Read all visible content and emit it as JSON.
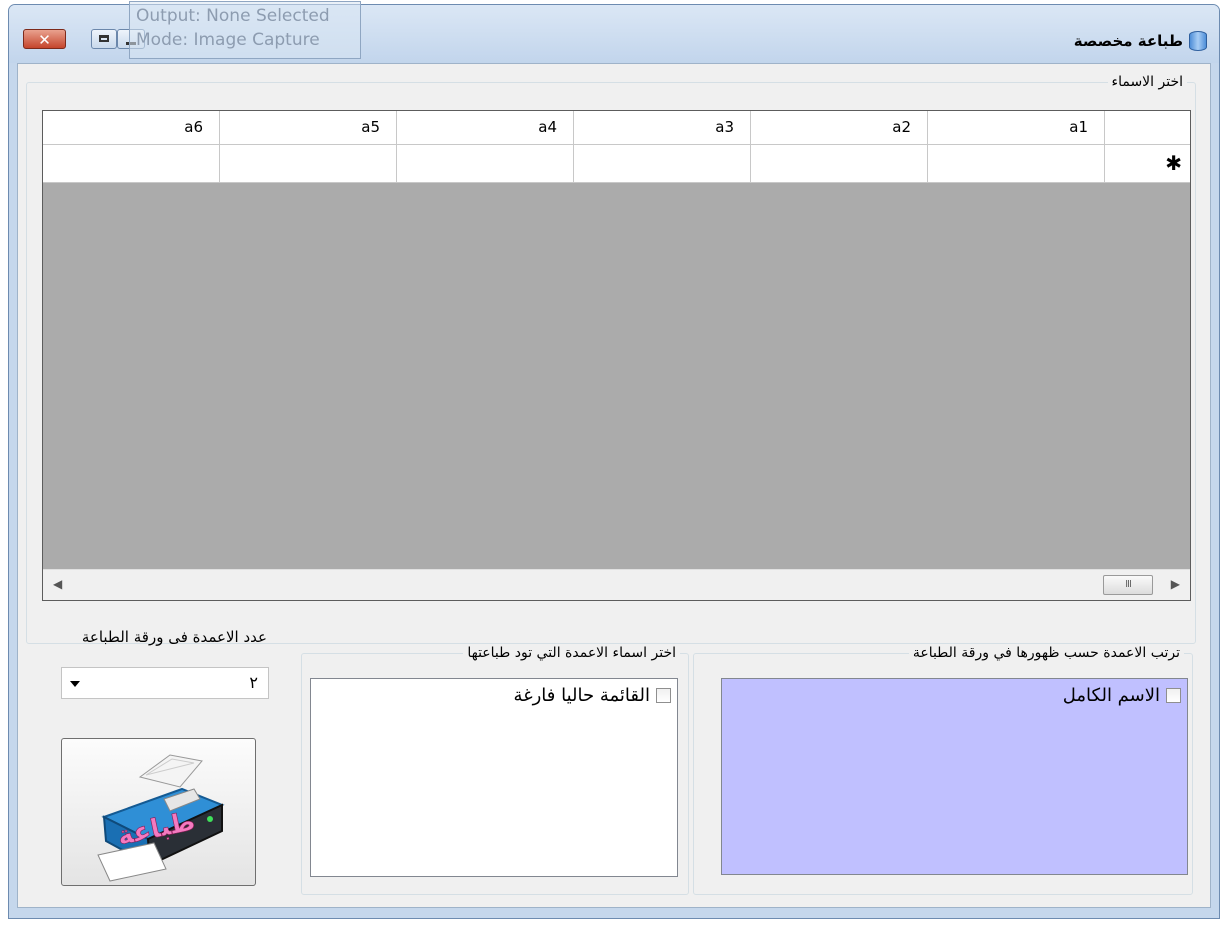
{
  "window": {
    "title": "طباعة مخصصة",
    "close_symbol": "✕"
  },
  "ghost_tooltip": {
    "line1": "Output: None Selected",
    "line2": "Mode: Image Capture"
  },
  "names_group": {
    "legend": "اختر الاسماء",
    "columns": [
      "a6",
      "a5",
      "a4",
      "a3",
      "a2",
      "a1"
    ],
    "new_row_marker": "✱",
    "scroll_thumb_grip": "III"
  },
  "column_count": {
    "label": "عدد الاعمدة فى ورقة الطباعة",
    "value": "٢"
  },
  "print_button": {
    "badge_text": "طباعة"
  },
  "select_columns": {
    "legend": "اختر اسماء الاعمدة التي تود طباعتها",
    "item_label": "القائمة حاليا فارغة"
  },
  "order_columns": {
    "legend": "ترتب الاعمدة حسب ظهورها في  ورقة الطباعة",
    "item_label": "الاسم الكامل"
  },
  "colors": {
    "order_list_bg": "#c0c0ff",
    "grid_bg": "#ababab",
    "close_button": "#c5452c"
  },
  "icons": {
    "window_icon": "database-icon",
    "print_icon": "printer-icon"
  }
}
